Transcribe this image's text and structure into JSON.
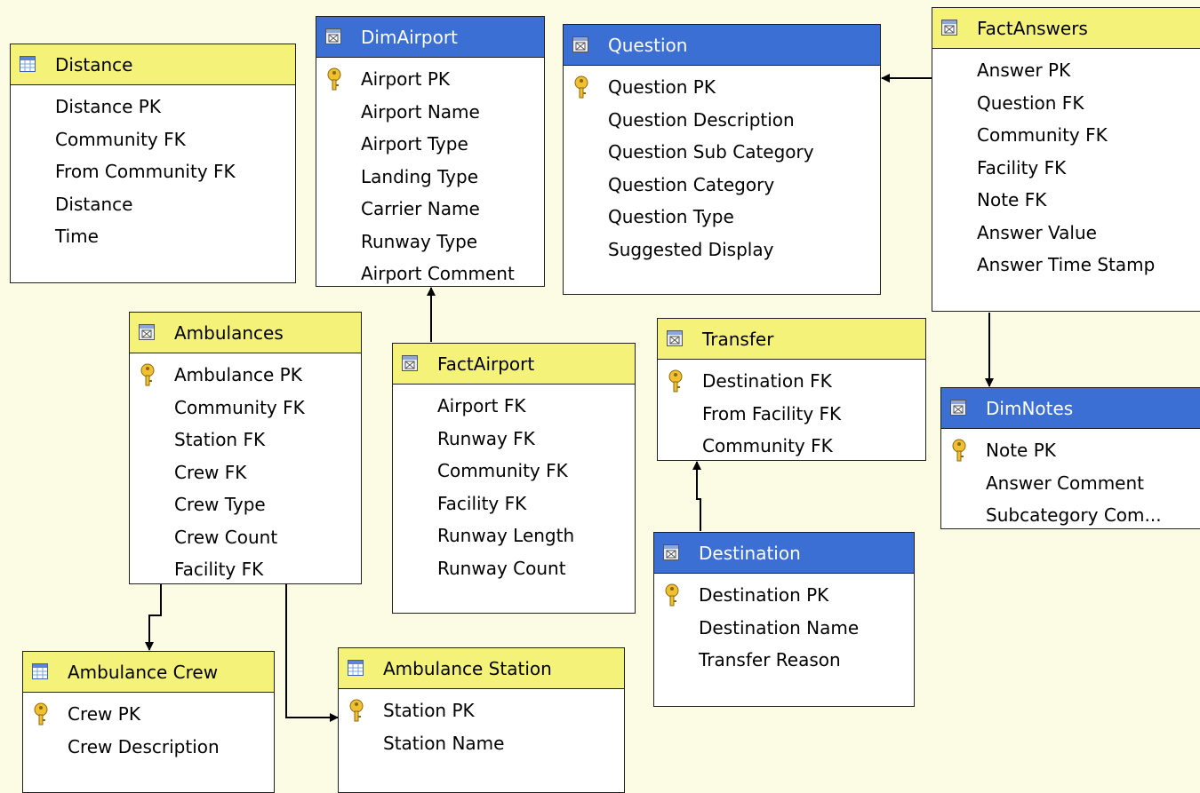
{
  "tables": {
    "distance": {
      "name": "Distance",
      "columns": [
        "Distance PK",
        "Community FK",
        "From Community FK",
        "Distance",
        "Time"
      ]
    },
    "dim_airport": {
      "name": "DimAirport",
      "columns": [
        "Airport PK",
        "Airport Name",
        "Airport Type",
        "Landing Type",
        "Carrier Name",
        "Runway Type",
        "Airport Comment"
      ]
    },
    "question": {
      "name": "Question",
      "columns": [
        "Question PK",
        "Question Description",
        "Question Sub Category",
        "Question Category",
        "Question Type",
        "Suggested Display"
      ]
    },
    "fact_answers": {
      "name": "FactAnswers",
      "columns": [
        "Answer PK",
        "Question FK",
        "Community FK",
        "Facility FK",
        "Note FK",
        "Answer Value",
        "Answer Time Stamp"
      ]
    },
    "ambulances": {
      "name": "Ambulances",
      "columns": [
        "Ambulance PK",
        "Community FK",
        "Station FK",
        "Crew FK",
        "Crew Type",
        "Crew Count",
        "Facility FK"
      ]
    },
    "fact_airport": {
      "name": "FactAirport",
      "columns": [
        "Airport FK",
        "Runway FK",
        "Community FK",
        "Facility FK",
        "Runway Length",
        "Runway Count"
      ]
    },
    "transfer": {
      "name": "Transfer",
      "columns": [
        "Destination FK",
        "From Facility FK",
        "Community FK"
      ]
    },
    "dim_notes": {
      "name": "DimNotes",
      "columns": [
        "Note PK",
        "Answer Comment",
        "Subcategory Com..."
      ]
    },
    "destination": {
      "name": "Destination",
      "columns": [
        "Destination PK",
        "Destination Name",
        "Transfer Reason"
      ]
    },
    "ambulance_crew": {
      "name": "Ambulance Crew",
      "columns": [
        "Crew PK",
        "Crew Description"
      ]
    },
    "ambulance_station": {
      "name": "Ambulance Station",
      "columns": [
        "Station PK",
        "Station Name"
      ]
    }
  },
  "colors": {
    "background": "#fcfbe3",
    "header_yellow": "#f5f27a",
    "header_blue": "#3b6fd3",
    "border": "#202020"
  }
}
